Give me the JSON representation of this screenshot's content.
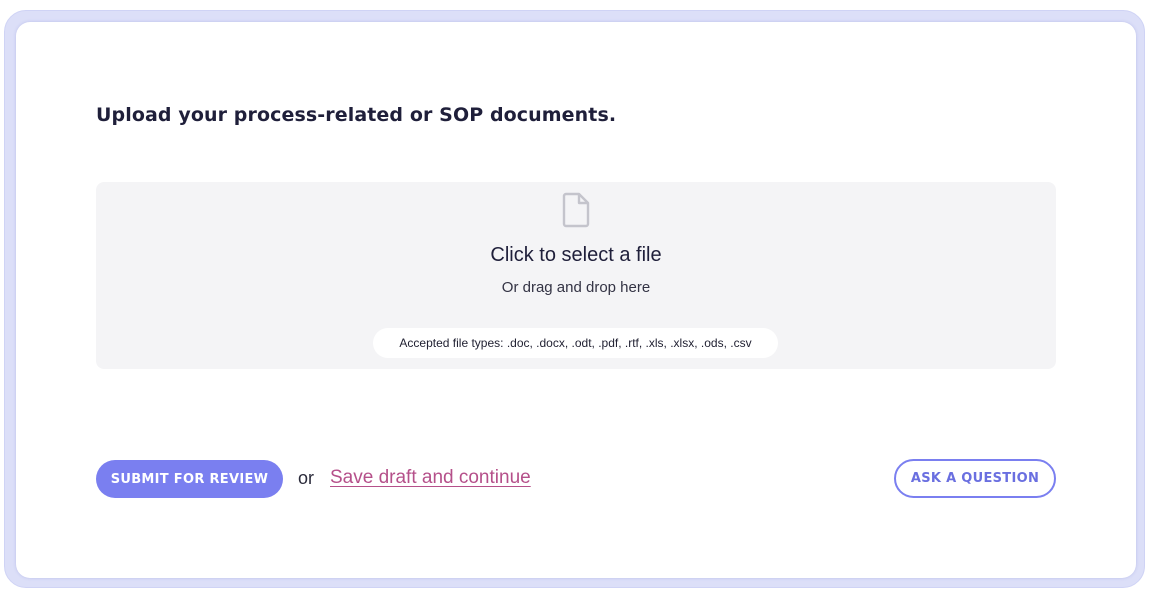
{
  "upload": {
    "heading": "Upload your process-related or SOP documents.",
    "dropzone": {
      "icon": "file-icon",
      "title": "Click to select a file",
      "subtitle": "Or drag and drop here",
      "accepted_types": "Accepted file types: .doc, .docx, .odt, .pdf, .rtf, .xls, .xlsx, .ods, .csv"
    }
  },
  "actions": {
    "submit_label": "SUBMIT FOR REVIEW",
    "or_label": "or",
    "save_draft_label": "Save draft and continue",
    "ask_question_label": "ASK A QUESTION"
  },
  "colors": {
    "accent": "#7a7ff0",
    "link": "#b5508a",
    "dropzone_bg": "#f4f4f6",
    "frame": "#dcdff8"
  }
}
